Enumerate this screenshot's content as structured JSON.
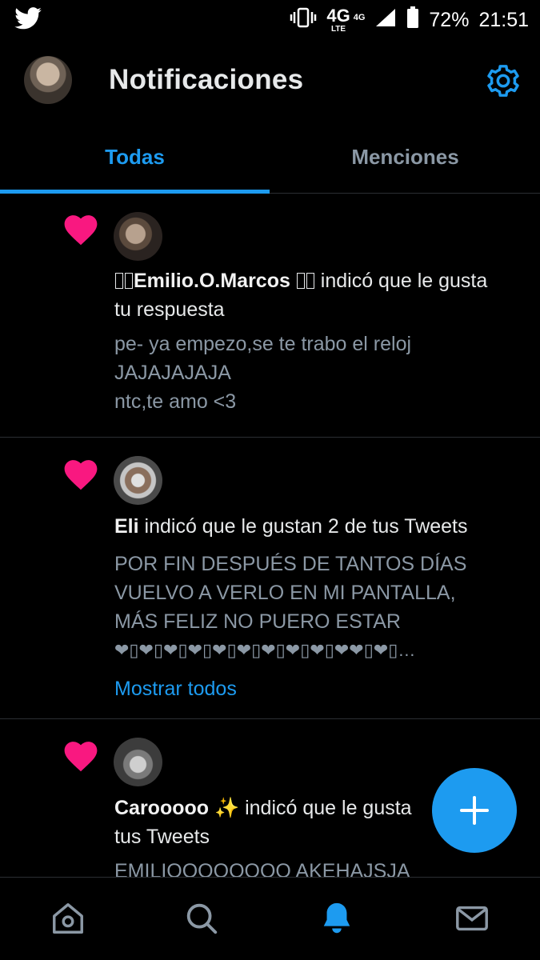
{
  "status_bar": {
    "network": "4G",
    "network_sub": "LTE",
    "network_secondary": "4G",
    "battery": "72%",
    "time": "21:51"
  },
  "header": {
    "title": "Notificaciones"
  },
  "tabs": [
    {
      "label": "Todas",
      "active": true
    },
    {
      "label": "Menciones",
      "active": false
    }
  ],
  "notifications": [
    {
      "icon": "heart-icon",
      "user": "Emilio.O.Marcos",
      "action_line1": " indicó que le gusta",
      "action_line2": "tu respuesta",
      "tweet": [
        "pe- ya empezo,se te trabo el reloj",
        "JAJAJAJAJA",
        "ntc,te amo <3"
      ]
    },
    {
      "icon": "heart-icon",
      "user": "Eli",
      "action_line1": " indicó que le gustan 2 de tus Tweets",
      "tweet": [
        "POR FIN DESPUÉS DE TANTOS DÍAS",
        "VUELVO A VERLO EN MI PANTALLA,",
        "MÁS FELIZ NO PUERO ESTAR",
        "❤▯❤▯❤▯❤▯❤▯❤▯❤▯❤▯❤▯❤❤▯❤▯…"
      ],
      "show_all": "Mostrar todos"
    },
    {
      "icon": "heart-icon",
      "user": "Carooooo",
      "user_emoji": "✨",
      "action_line1": " indicó que le gusta",
      "action_line2": "tus Tweets",
      "tweet": [
        "EMILIOOOOOOOO AKEHAJSJA"
      ]
    }
  ],
  "colors": {
    "accent": "#1d9bf0",
    "like": "#f91880",
    "background": "#000000",
    "divider": "#2b2f33"
  },
  "nav": [
    "home-icon",
    "search-icon",
    "notifications-bell-icon",
    "messages-mail-icon"
  ]
}
